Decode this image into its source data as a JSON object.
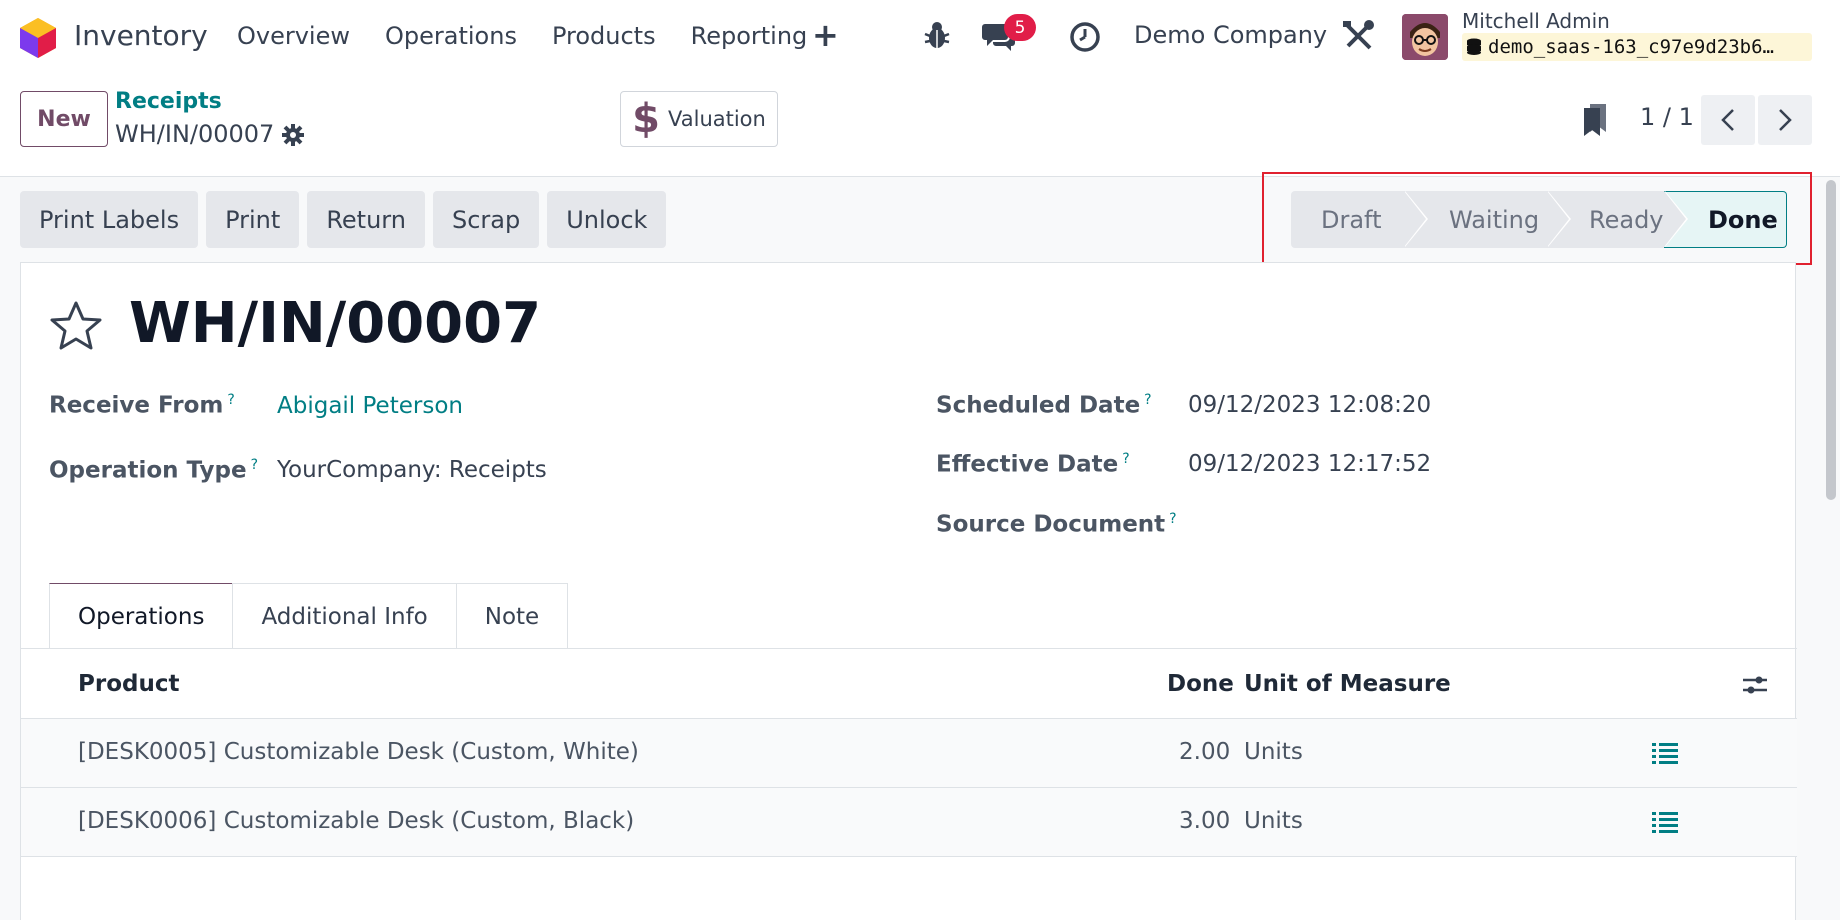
{
  "navbar": {
    "app_name": "Inventory",
    "menu": [
      "Overview",
      "Operations",
      "Products",
      "Reporting"
    ],
    "add_label": "+",
    "chat_badge": "5",
    "company": "Demo Company",
    "user_name": "Mitchell Admin",
    "database": "demo_saas-163_c97e9d23b6…"
  },
  "control": {
    "new_label": "New",
    "breadcrumb_parent": "Receipts",
    "breadcrumb_current": "WH/IN/00007",
    "valuation_label": "Valuation",
    "pager": "1 / 1"
  },
  "actions": [
    "Print Labels",
    "Print",
    "Return",
    "Scrap",
    "Unlock"
  ],
  "status": {
    "stages": [
      "Draft",
      "Waiting",
      "Ready",
      "Done"
    ],
    "current": "Done"
  },
  "form": {
    "title": "WH/IN/00007",
    "receive_from_label": "Receive From",
    "receive_from_value": "Abigail Peterson",
    "operation_type_label": "Operation Type",
    "operation_type_value": "YourCompany: Receipts",
    "scheduled_date_label": "Scheduled Date",
    "scheduled_date_value": "09/12/2023 12:08:20",
    "effective_date_label": "Effective Date",
    "effective_date_value": "09/12/2023 12:17:52",
    "source_document_label": "Source Document",
    "help_mark": "?"
  },
  "tabs": [
    "Operations",
    "Additional Info",
    "Note"
  ],
  "table": {
    "columns": [
      "Product",
      "Done",
      "Unit of Measure"
    ],
    "rows": [
      {
        "product": "[DESK0005] Customizable Desk (Custom, White)",
        "done": "2.00",
        "uom": "Units"
      },
      {
        "product": "[DESK0006] Customizable Desk (Custom, Black)",
        "done": "3.00",
        "uom": "Units"
      }
    ]
  },
  "colors": {
    "brand": "#714b67",
    "link": "#017e84",
    "highlight": "#e0212f"
  }
}
